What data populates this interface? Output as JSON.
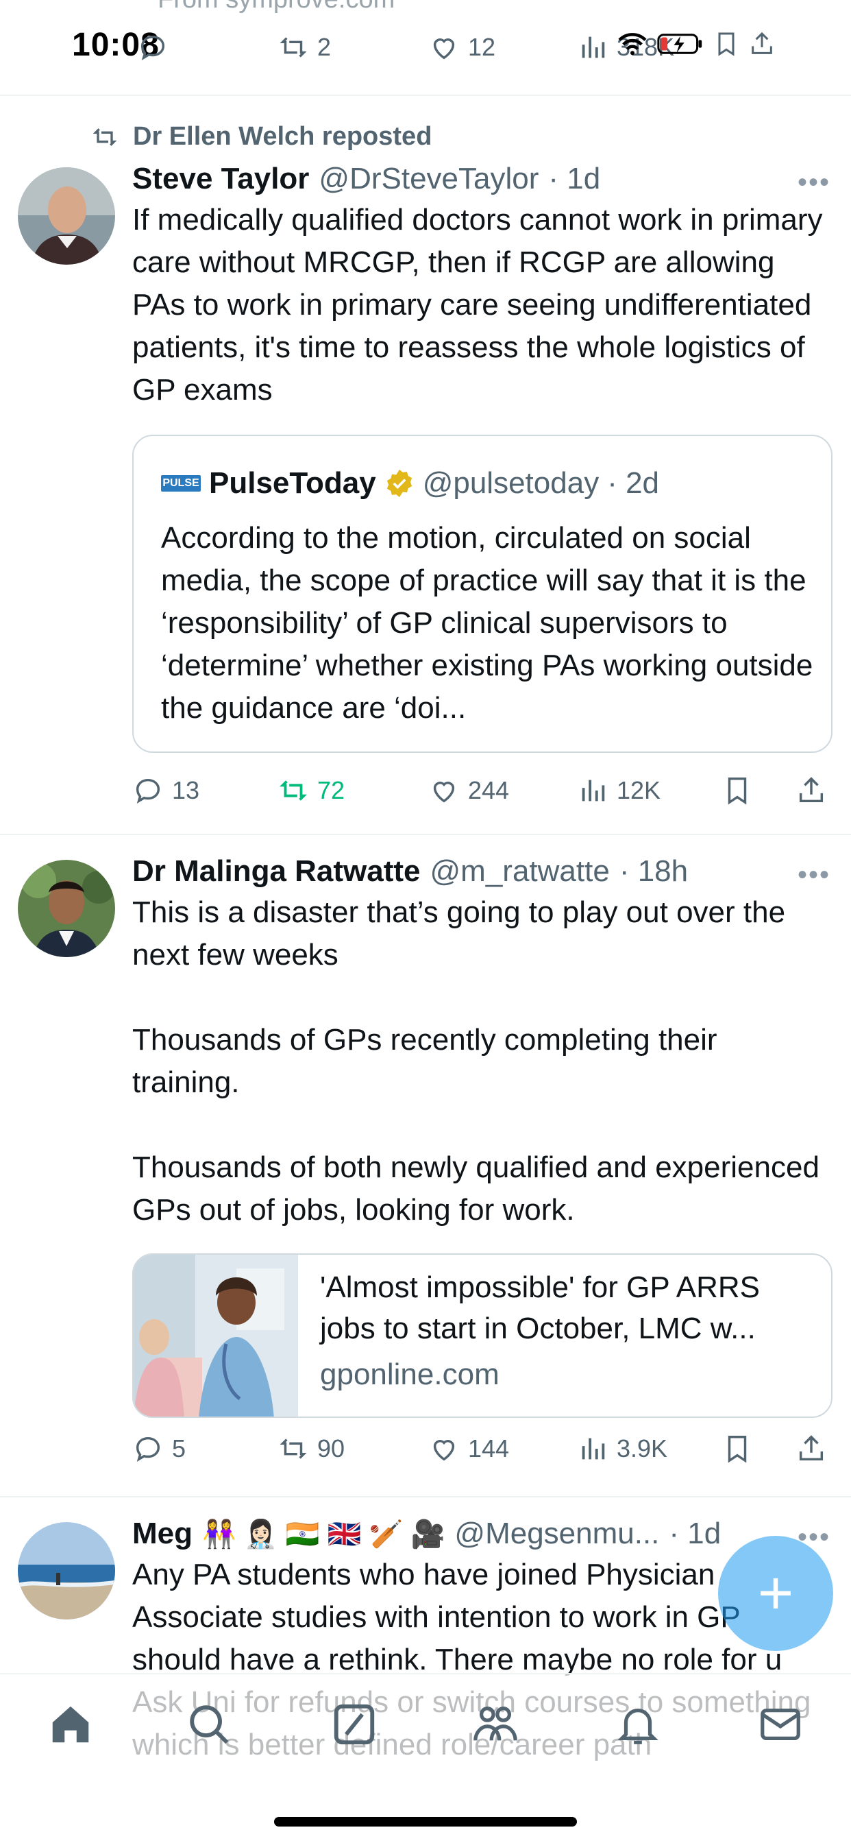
{
  "status": {
    "time": "10:08",
    "faded_text": "From symprove.com"
  },
  "top_actions": {
    "retweets": "2",
    "likes": "12",
    "views": "318K"
  },
  "tweet1": {
    "repost_label": "Dr Ellen Welch reposted",
    "name": "Steve Taylor",
    "handle": "@DrSteveTaylor",
    "time": "· 1d",
    "text": "If medically qualified doctors cannot work in primary care without MRCGP, then if RCGP are allowing PAs to work in primary care seeing undifferentiated patients, it's time to reassess the whole logistics of GP exams",
    "quote": {
      "logo_text": "PULSE",
      "name": "PulseToday",
      "handle": "@pulsetoday",
      "time": "· 2d",
      "text": "According to the motion, circulated on social media, the scope of practice will say that it is the ‘responsibility’ of GP clinical supervisors to ‘determine’ whether existing PAs working outside the guidance are ‘doi..."
    },
    "replies": "13",
    "retweets": "72",
    "likes": "244",
    "views": "12K"
  },
  "tweet2": {
    "name": "Dr Malinga Ratwatte",
    "handle": "@m_ratwatte",
    "time": "· 18h",
    "text": "This is a disaster that’s going to play out over the next few weeks\n\nThousands of GPs recently completing their training.\n\nThousands of both newly qualified and experienced GPs out of jobs, looking for work.",
    "card": {
      "title": "'Almost impossible' for GP ARRS jobs to start in October, LMC w...",
      "domain": "gponline.com"
    },
    "replies": "5",
    "retweets": "90",
    "likes": "144",
    "views": "3.9K"
  },
  "tweet3": {
    "name": "Meg",
    "emojis": "👭 👩🏻‍⚕️ 🇮🇳 🇬🇧 🏏 🎥",
    "handle": "@Megsenmu...",
    "time": "· 1d",
    "text": "Any PA students who have joined Physician Associate studies with intention to work in GP should have a rethink. There maybe no role for u\nAsk Uni for refunds or switch courses to something which is better defined role/career path"
  },
  "fab_label": "+",
  "colors": {
    "accent": "#1d9bf0",
    "retweet_green": "#00ba7c",
    "muted": "#536471"
  }
}
